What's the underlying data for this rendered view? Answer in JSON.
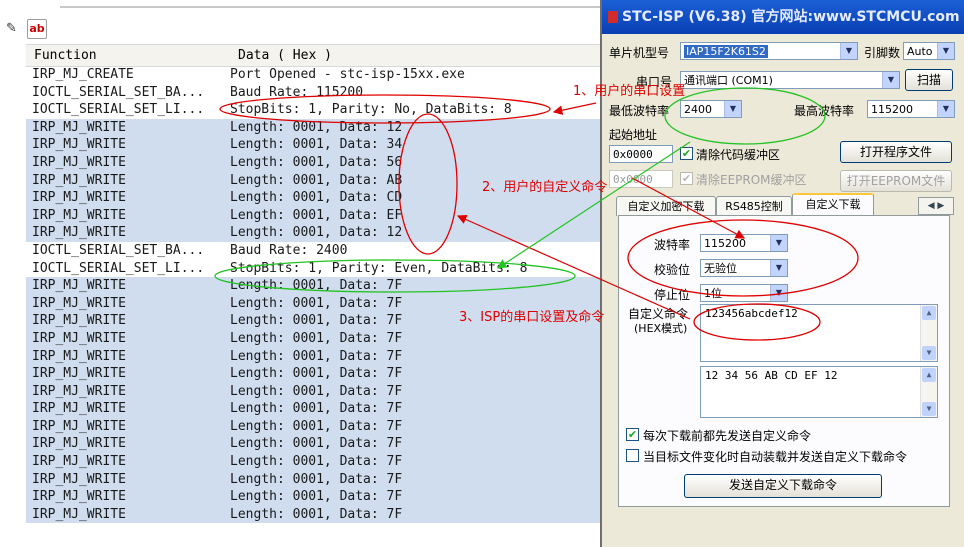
{
  "log": {
    "columns": [
      "Function",
      "Data ( Hex )"
    ],
    "rows": [
      {
        "fn": "IRP_MJ_CREATE",
        "data": "Port Opened - stc-isp-15xx.exe",
        "sel": false
      },
      {
        "fn": "IOCTL_SERIAL_SET_BA...",
        "data": "Baud Rate: 115200",
        "sel": false
      },
      {
        "fn": "IOCTL_SERIAL_SET_LI...",
        "data": "StopBits: 1, Parity: No, DataBits: 8",
        "sel": false
      },
      {
        "fn": "IRP_MJ_WRITE",
        "data": "Length: 0001, Data: 12",
        "sel": true
      },
      {
        "fn": "IRP_MJ_WRITE",
        "data": "Length: 0001, Data: 34",
        "sel": true
      },
      {
        "fn": "IRP_MJ_WRITE",
        "data": "Length: 0001, Data: 56",
        "sel": true
      },
      {
        "fn": "IRP_MJ_WRITE",
        "data": "Length: 0001, Data: AB",
        "sel": true
      },
      {
        "fn": "IRP_MJ_WRITE",
        "data": "Length: 0001, Data: CD",
        "sel": true
      },
      {
        "fn": "IRP_MJ_WRITE",
        "data": "Length: 0001, Data: EF",
        "sel": true
      },
      {
        "fn": "IRP_MJ_WRITE",
        "data": "Length: 0001, Data: 12",
        "sel": true
      },
      {
        "fn": "IOCTL_SERIAL_SET_BA...",
        "data": "Baud Rate: 2400",
        "sel": false
      },
      {
        "fn": "IOCTL_SERIAL_SET_LI...",
        "data": "StopBits: 1, Parity: Even, DataBits: 8",
        "sel": false
      },
      {
        "fn": "IRP_MJ_WRITE",
        "data": "Length: 0001, Data: 7F",
        "sel": true
      },
      {
        "fn": "IRP_MJ_WRITE",
        "data": "Length: 0001, Data: 7F",
        "sel": true
      },
      {
        "fn": "IRP_MJ_WRITE",
        "data": "Length: 0001, Data: 7F",
        "sel": true
      },
      {
        "fn": "IRP_MJ_WRITE",
        "data": "Length: 0001, Data: 7F",
        "sel": true
      },
      {
        "fn": "IRP_MJ_WRITE",
        "data": "Length: 0001, Data: 7F",
        "sel": true
      },
      {
        "fn": "IRP_MJ_WRITE",
        "data": "Length: 0001, Data: 7F",
        "sel": true
      },
      {
        "fn": "IRP_MJ_WRITE",
        "data": "Length: 0001, Data: 7F",
        "sel": true
      },
      {
        "fn": "IRP_MJ_WRITE",
        "data": "Length: 0001, Data: 7F",
        "sel": true
      },
      {
        "fn": "IRP_MJ_WRITE",
        "data": "Length: 0001, Data: 7F",
        "sel": true
      },
      {
        "fn": "IRP_MJ_WRITE",
        "data": "Length: 0001, Data: 7F",
        "sel": true
      },
      {
        "fn": "IRP_MJ_WRITE",
        "data": "Length: 0001, Data: 7F",
        "sel": true
      },
      {
        "fn": "IRP_MJ_WRITE",
        "data": "Length: 0001, Data: 7F",
        "sel": true
      },
      {
        "fn": "IRP_MJ_WRITE",
        "data": "Length: 0001, Data: 7F",
        "sel": true
      },
      {
        "fn": "IRP_MJ_WRITE",
        "data": "Length: 0001, Data: 7F",
        "sel": true
      }
    ]
  },
  "toolbar": {
    "ab_label": "ab"
  },
  "isp": {
    "title": "STC-ISP (V6.38) 官方网站:www.STCMCU.com",
    "mcu_label": "单片机型号",
    "mcu_value": "IAP15F2K61S2",
    "pin_label": "引脚数",
    "pin_value": "Auto",
    "port_label": "串口号",
    "port_value": "通讯端口 (COM1)",
    "scan_label": "扫描",
    "min_baud_label": "最低波特率",
    "min_baud_value": "2400",
    "max_baud_label": "最高波特率",
    "max_baud_value": "115200",
    "start_addr_label": "起始地址",
    "code_addr": "0x0000",
    "clear_code_label": "清除代码缓冲区",
    "open_prog_label": "打开程序文件",
    "eeprom_addr": "0x0000",
    "clear_eeprom_label": "清除EEPROM缓冲区",
    "open_eeprom_label": "打开EEPROM文件",
    "tabs": [
      "自定义加密下载",
      "RS485控制",
      "自定义下载"
    ],
    "baud_label": "波特率",
    "baud_value": "115200",
    "parity_label": "校验位",
    "parity_value": "无验位",
    "stop_label": "停止位",
    "stop_value": "1位",
    "cmd_label": "自定义命令",
    "cmd_sub_label": "(HEX模式)",
    "cmd_value": "123456abcdef12",
    "hex_preview": "12 34 56 AB CD EF 12",
    "opt1_label": "每次下载前都先发送自定义命令",
    "opt2_label": "当目标文件变化时自动装载并发送自定义下载命令",
    "send_label": "发送自定义下载命令"
  },
  "annotations": {
    "a1": "1、用户的串口设置",
    "a2": "2、用户的自定义命令",
    "a3": "3、ISP的串口设置及命令"
  }
}
